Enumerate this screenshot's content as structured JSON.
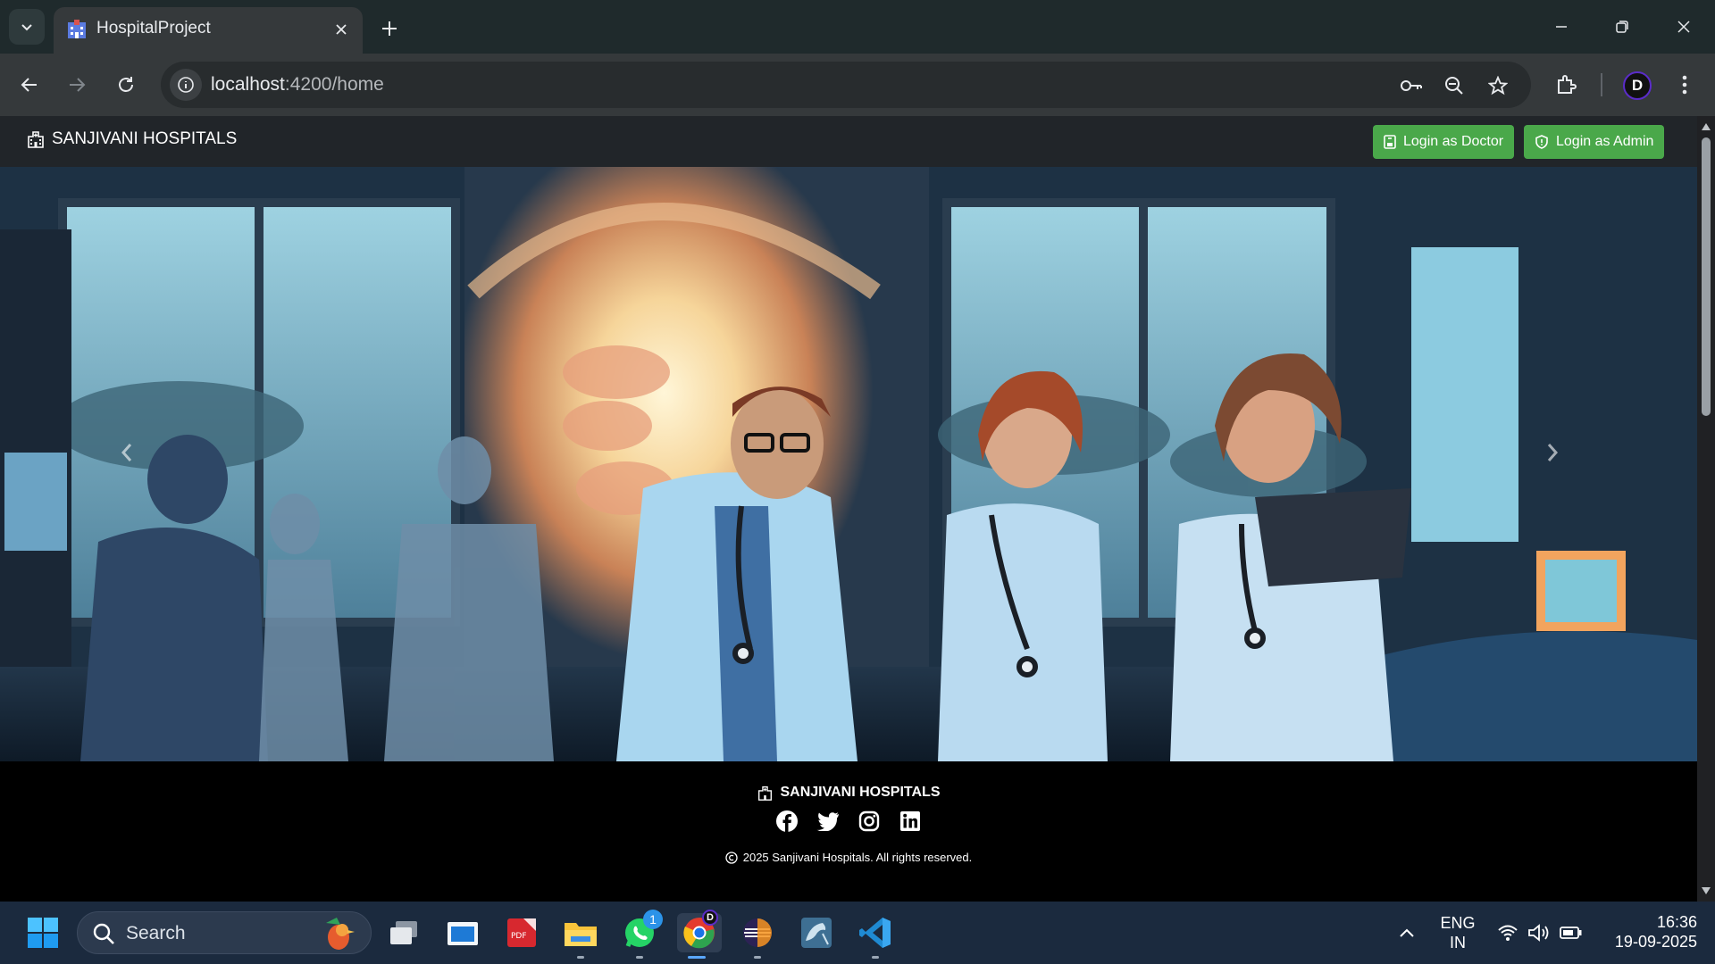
{
  "browser": {
    "tab_title": "HospitalProject",
    "url_host": "localhost",
    "url_path": ":4200/home",
    "profile_initial": "D"
  },
  "navbar": {
    "brand": "SANJIVANI HOSPITALS",
    "doctor_login": "Login as Doctor",
    "admin_login": "Login as Admin",
    "button_color": "#4aa84a"
  },
  "hero": {
    "image": "hospital-staff-illustration"
  },
  "footer": {
    "brand": "SANJIVANI HOSPITALS",
    "socials": [
      "facebook-icon",
      "twitter-icon",
      "instagram-icon",
      "linkedin-icon"
    ],
    "copyright": "2025 Sanjivani Hospitals. All rights reserved."
  },
  "taskbar": {
    "search_label": "Search",
    "whatsapp_badge": "1",
    "lang_line1": "ENG",
    "lang_line2": "IN",
    "time": "16:36",
    "date": "19-09-2025"
  }
}
